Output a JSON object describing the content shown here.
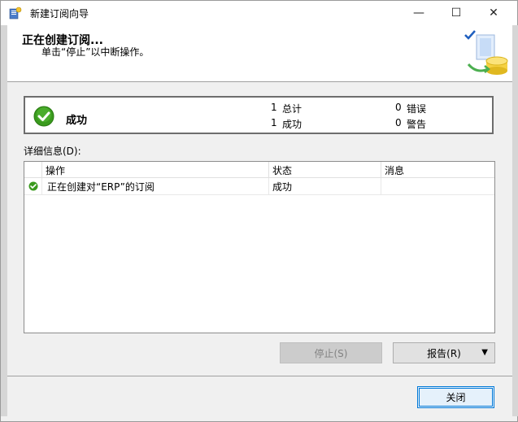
{
  "window": {
    "title": "新建订阅向导",
    "controls": {
      "minimize": "—",
      "maximize": "☐",
      "close": "✕"
    }
  },
  "header": {
    "title": "正在创建订阅...",
    "subtitle": "单击“停止”以中断操作。"
  },
  "summary": {
    "status": "成功",
    "total_count": "1",
    "total_label": "总计",
    "success_count": "1",
    "success_label": "成功",
    "error_count": "0",
    "error_label": "错误",
    "warning_count": "0",
    "warning_label": "警告"
  },
  "details": {
    "label": "详细信息(D):",
    "columns": [
      "操作",
      "状态",
      "消息"
    ],
    "rows": [
      {
        "action": "正在创建对“ERP”的订阅",
        "status": "成功",
        "message": ""
      }
    ]
  },
  "buttons": {
    "stop": "停止(S)",
    "report": "报告(R)",
    "report_arrow": "▼",
    "close": "关闭"
  },
  "colors": {
    "success_green": "#3a9a1e",
    "accent_blue": "#0078d7"
  }
}
